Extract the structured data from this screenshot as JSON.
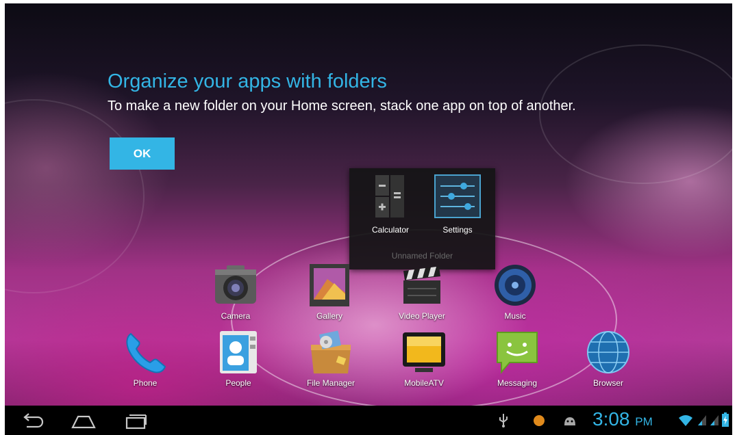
{
  "intro": {
    "title": "Organize your apps with folders",
    "text": "To make a new folder on your Home screen, stack one app on top of another.",
    "ok_label": "OK"
  },
  "folder": {
    "name": "Unnamed Folder",
    "apps": [
      {
        "label": "Calculator",
        "icon": "calculator-icon"
      },
      {
        "label": "Settings",
        "icon": "settings-icon"
      }
    ]
  },
  "workspace_apps": [
    {
      "label": "Camera",
      "icon": "camera-icon"
    },
    {
      "label": "Gallery",
      "icon": "gallery-icon"
    },
    {
      "label": "Video Player",
      "icon": "video-player-icon"
    },
    {
      "label": "Music",
      "icon": "music-icon"
    }
  ],
  "hotseat_apps": [
    {
      "label": "Phone",
      "icon": "phone-icon"
    },
    {
      "label": "People",
      "icon": "people-icon"
    },
    {
      "label": "File Manager",
      "icon": "file-manager-icon"
    },
    {
      "label": "MobileATV",
      "icon": "tv-icon"
    },
    {
      "label": "Messaging",
      "icon": "messaging-icon"
    },
    {
      "label": "Browser",
      "icon": "browser-icon"
    }
  ],
  "status_bar": {
    "time": "3:08",
    "ampm": "PM",
    "icons": [
      "usb-icon",
      "notification-orange-icon",
      "android-debug-icon",
      "wifi-icon",
      "signal-icon",
      "signal-icon",
      "battery-charging-icon"
    ]
  },
  "nav": {
    "buttons": [
      "back-icon",
      "home-icon",
      "recent-apps-icon"
    ]
  },
  "colors": {
    "accent": "#33b5e5",
    "folder_bg": "#141416",
    "navbar_bg": "#000000"
  }
}
